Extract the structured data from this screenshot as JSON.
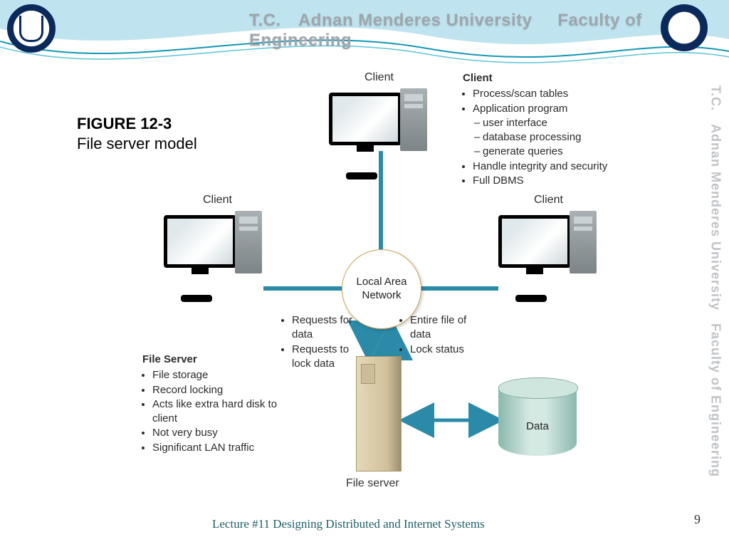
{
  "header": {
    "tc": "T.C.",
    "univ": "Adnan Menderes University",
    "fac": "Faculty of Engineering"
  },
  "figure": {
    "title": "FIGURE 12-3",
    "subtitle": "File server model"
  },
  "diagram": {
    "lan": "Local Area Network",
    "client_label": "Client",
    "server_label": "File server",
    "data_label": "Data",
    "client_block": {
      "heading": "Client",
      "bullets": [
        "Process/scan tables",
        "Application program",
        "Handle integrity and security",
        "Full DBMS"
      ],
      "app_sub": [
        "user interface",
        "database processing",
        "generate queries"
      ]
    },
    "fileserver_block": {
      "heading": "File Server",
      "bullets": [
        "File storage",
        "Record locking",
        "Acts like extra hard disk to client",
        "Not very busy",
        "Significant LAN traffic"
      ]
    },
    "down_left": [
      "Requests for data",
      "Requests to lock data"
    ],
    "down_right": [
      "Entire file of data",
      "Lock status"
    ]
  },
  "footer": {
    "lecture": "Lecture #11 Designing Distributed and Internet Systems",
    "page": "9"
  }
}
